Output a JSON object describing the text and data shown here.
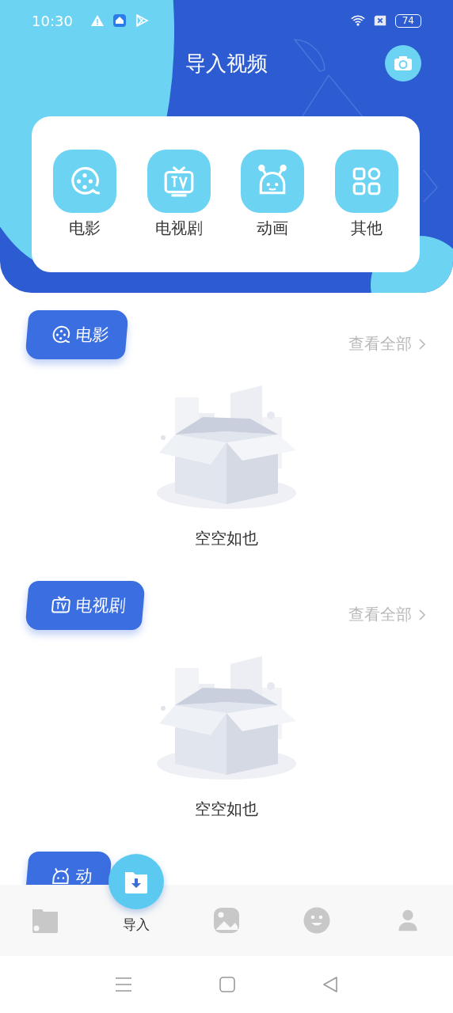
{
  "status_bar": {
    "time": "10:30",
    "battery": "74"
  },
  "header": {
    "title": "导入视频"
  },
  "categories": [
    {
      "kind": "film",
      "label": "电影"
    },
    {
      "kind": "tv",
      "label": "电视剧"
    },
    {
      "kind": "robot",
      "label": "动画"
    },
    {
      "kind": "grid",
      "label": "其他"
    }
  ],
  "sections": [
    {
      "kind": "film",
      "title": "电影",
      "link": "查看全部",
      "empty_text": "空空如也"
    },
    {
      "kind": "tv",
      "title": "电视剧",
      "link": "查看全部",
      "empty_text": "空空如也"
    },
    {
      "kind": "robot",
      "title": "动"
    }
  ],
  "tab_bar": [
    {
      "kind": "folder",
      "selected": false
    },
    {
      "kind": "import",
      "label": "导入",
      "selected": true
    },
    {
      "kind": "image",
      "selected": false
    },
    {
      "kind": "smile",
      "selected": false
    },
    {
      "kind": "person",
      "selected": false
    }
  ]
}
